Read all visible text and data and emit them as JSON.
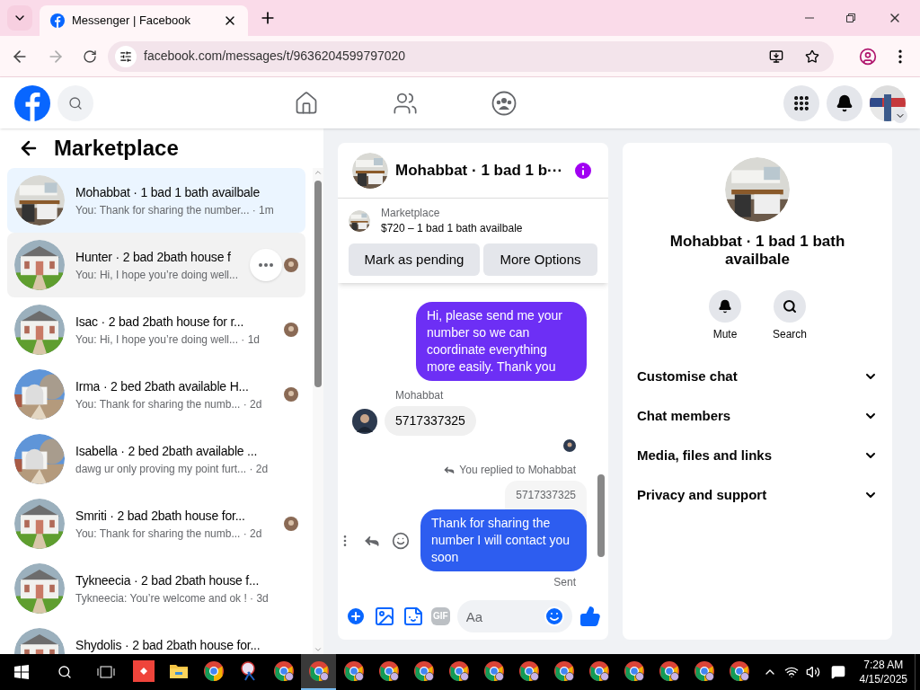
{
  "browser": {
    "tab_title": "Messenger | Facebook",
    "url": "facebook.com/messages/t/9636204599797020"
  },
  "sidebar": {
    "title": "Marketplace",
    "conversations": [
      {
        "title": "Mohabbat · 1 bad 1 bath availbale",
        "meta": "You: Thank for sharing the number... · 1m",
        "selected": true,
        "hovered": false,
        "receipt": false
      },
      {
        "title": "Hunter · 2 bad 2bath house f",
        "meta": "You: Hi, I hope you’re doing well...",
        "selected": false,
        "hovered": true,
        "receipt": true
      },
      {
        "title": "Isac · 2 bad 2bath house for r...",
        "meta": "You: Hi, I hope you’re doing well... · 1d",
        "selected": false,
        "hovered": false,
        "receipt": true
      },
      {
        "title": "Irma · 2 bed 2bath available H...",
        "meta": "You: Thank for sharing the numb... · 2d",
        "selected": false,
        "hovered": false,
        "receipt": true
      },
      {
        "title": "Isabella · 2 bed 2bath available ...",
        "meta": "dawg ur only proving my point furt... · 2d",
        "selected": false,
        "hovered": false,
        "receipt": false
      },
      {
        "title": "Smriti · 2 bad 2bath house for...",
        "meta": "You: Thank for sharing the numb... · 2d",
        "selected": false,
        "hovered": false,
        "receipt": true
      },
      {
        "title": "Tykneecia · 2 bad 2bath house f...",
        "meta": "Tykneecia: You’re welcome and ok ! · 3d",
        "selected": false,
        "hovered": false,
        "receipt": false
      },
      {
        "title": "Shydolis · 2 bad 2bath house for...",
        "selected": false,
        "hovered": false,
        "receipt": false
      }
    ]
  },
  "chat": {
    "title": "Mohabbat · 1 bad 1 b···",
    "listing": {
      "label": "Marketplace",
      "price": "$720 – 1 bad 1 bath availbale",
      "buttons": [
        "Mark as pending",
        "More Options"
      ]
    },
    "messages": [
      {
        "kind": "outgoing",
        "color": "#6d2ff5",
        "text": "Hi, please send me your number so we can coordinate everything more easily. Thank you"
      },
      {
        "kind": "sender",
        "text": "Mohabbat"
      },
      {
        "kind": "incoming",
        "text": "5717337325"
      },
      {
        "kind": "receipt"
      },
      {
        "kind": "reply_note",
        "text": "You replied to Mohabbat"
      },
      {
        "kind": "quote",
        "text": "5717337325"
      },
      {
        "kind": "outgoing",
        "color": "#2d5df0",
        "text": "Thank for sharing  the number I will contact you soon",
        "actions": true
      },
      {
        "kind": "status",
        "text": "Sent"
      }
    ],
    "composer": {
      "gif_label": "GIF",
      "placeholder": "Aa"
    }
  },
  "details": {
    "name": "Mohabbat · 1 bad 1 bath availbale",
    "actions": [
      "Mute",
      "Search"
    ],
    "sections": [
      {
        "label": "Customise chat",
        "expanded": false
      },
      {
        "label": "Chat members",
        "expanded": false
      },
      {
        "label": "Media, files and links",
        "expanded": false
      },
      {
        "label": "Privacy and support",
        "expanded": false
      }
    ]
  },
  "taskbar": {
    "apps": [
      {
        "kind": "anydesk",
        "selected": false
      },
      {
        "kind": "folder",
        "selected": false
      },
      {
        "kind": "chrome",
        "selected": false
      },
      {
        "kind": "snip",
        "selected": false
      },
      {
        "kind": "chrome",
        "selected": false
      },
      {
        "kind": "chrome",
        "selected": true
      },
      {
        "kind": "chrome",
        "selected": false
      },
      {
        "kind": "chrome",
        "selected": false
      },
      {
        "kind": "chrome",
        "selected": false
      },
      {
        "kind": "chrome",
        "selected": false
      },
      {
        "kind": "chrome",
        "selected": false
      },
      {
        "kind": "chrome",
        "selected": false
      },
      {
        "kind": "chrome",
        "selected": false
      },
      {
        "kind": "chrome",
        "selected": false
      },
      {
        "kind": "chrome",
        "selected": false
      },
      {
        "kind": "chrome",
        "selected": false
      },
      {
        "kind": "chrome",
        "selected": false
      },
      {
        "kind": "chrome",
        "selected": false
      }
    ],
    "time": "7:28 AM",
    "date": "4/15/2025"
  }
}
